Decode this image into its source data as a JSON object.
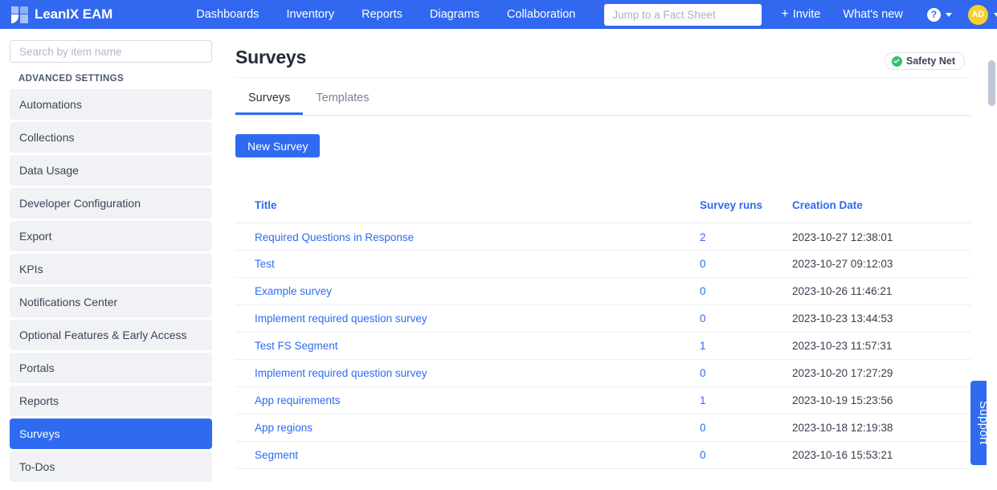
{
  "topnav": {
    "brand": "LeanIX EAM",
    "logo_icon": "leanix-logo-icon",
    "links": [
      "Dashboards",
      "Inventory",
      "Reports",
      "Diagrams",
      "Collaboration"
    ],
    "search_placeholder": "Jump to a Fact Sheet",
    "search_value": "",
    "invite_label": "Invite",
    "invite_icon": "plus-icon",
    "whats_new_label": "What's new",
    "help_icon": "question-mark-icon",
    "help_caret_icon": "chevron-down-icon",
    "avatar_initials": "AD",
    "avatar_caret_icon": "chevron-down-icon",
    "bg_color": "#3168ef"
  },
  "sidebar": {
    "search_placeholder": "Search by item name",
    "search_value": "",
    "heading": "ADVANCED SETTINGS",
    "items": [
      {
        "label": "Automations",
        "active": false
      },
      {
        "label": "Collections",
        "active": false
      },
      {
        "label": "Data Usage",
        "active": false
      },
      {
        "label": "Developer Configuration",
        "active": false
      },
      {
        "label": "Export",
        "active": false
      },
      {
        "label": "KPIs",
        "active": false
      },
      {
        "label": "Notifications Center",
        "active": false
      },
      {
        "label": "Optional Features & Early Access",
        "active": false
      },
      {
        "label": "Portals",
        "active": false
      },
      {
        "label": "Reports",
        "active": false
      },
      {
        "label": "Surveys",
        "active": true
      },
      {
        "label": "To-Dos",
        "active": false
      }
    ],
    "active_color": "#2f6bf0"
  },
  "main": {
    "page_title": "Surveys",
    "safety_net": {
      "label": "Safety Net",
      "icon": "check-circle-icon",
      "color": "#2ec36b"
    },
    "tabs": [
      {
        "label": "Surveys",
        "active": true
      },
      {
        "label": "Templates",
        "active": false
      }
    ],
    "new_survey_label": "New Survey",
    "table": {
      "columns": [
        "Title",
        "Survey runs",
        "Creation Date"
      ],
      "rows": [
        {
          "title": "Required Questions in Response",
          "runs": "2",
          "date": "2023-10-27 12:38:01"
        },
        {
          "title": "Test",
          "runs": "0",
          "date": "2023-10-27 09:12:03"
        },
        {
          "title": "Example survey",
          "runs": "0",
          "date": "2023-10-26 11:46:21"
        },
        {
          "title": "Implement required question survey",
          "runs": "0",
          "date": "2023-10-23 13:44:53"
        },
        {
          "title": "Test FS Segment",
          "runs": "1",
          "date": "2023-10-23 11:57:31"
        },
        {
          "title": "Implement required question survey",
          "runs": "0",
          "date": "2023-10-20 17:27:29"
        },
        {
          "title": "App requirements",
          "runs": "1",
          "date": "2023-10-19 15:23:56"
        },
        {
          "title": "App regions",
          "runs": "0",
          "date": "2023-10-18 12:19:38"
        },
        {
          "title": "Segment",
          "runs": "0",
          "date": "2023-10-16 15:53:21"
        }
      ]
    }
  },
  "support": {
    "label": "Support"
  }
}
